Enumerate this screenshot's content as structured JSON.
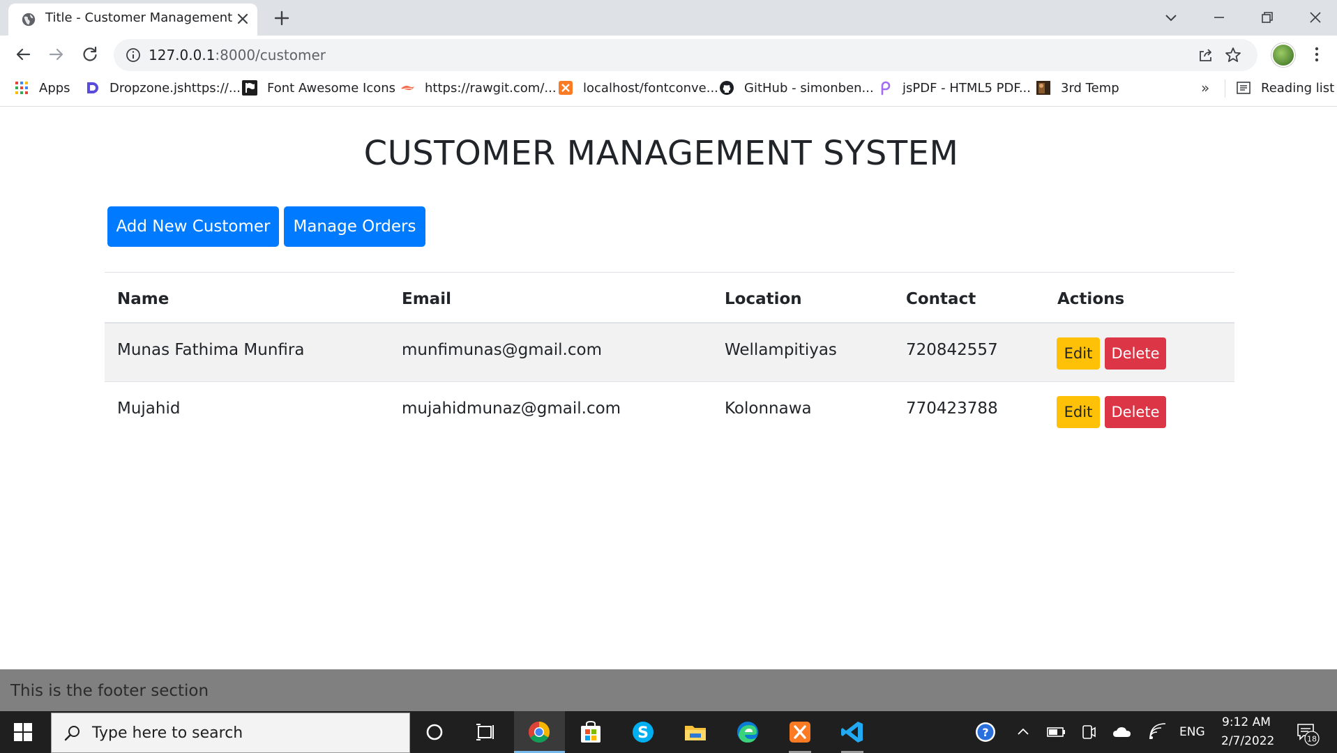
{
  "browser": {
    "tab_title": "Title - Customer Management",
    "url_host": "127.0.0.1",
    "url_path": ":8000/customer",
    "bookmarks": [
      {
        "label": "Apps",
        "icon": "apps-grid-icon"
      },
      {
        "label": "Dropzone.jshttps://...",
        "icon": "dropzone-icon"
      },
      {
        "label": "Font Awesome Icons",
        "icon": "font-awesome-flag-icon"
      },
      {
        "label": "https://rawgit.com/...",
        "icon": "rawgit-icon"
      },
      {
        "label": "localhost/fontconve...",
        "icon": "xampp-icon"
      },
      {
        "label": "GitHub - simonben...",
        "icon": "github-icon"
      },
      {
        "label": "jsPDF - HTML5 PDF...",
        "icon": "jspdf-icon"
      },
      {
        "label": "3rd Temp",
        "icon": "template-thumbnail-icon"
      }
    ],
    "bookmarks_overflow": "»",
    "reading_list": "Reading list"
  },
  "page": {
    "title": "CUSTOMER MANAGEMENT SYSTEM",
    "buttons": {
      "add_customer": "Add New Customer",
      "manage_orders": "Manage Orders"
    },
    "table": {
      "headers": [
        "Name",
        "Email",
        "Location",
        "Contact",
        "Actions"
      ],
      "rows": [
        {
          "name": "Munas Fathima Munfira",
          "email": "munfimunas@gmail.com",
          "location": "Wellampitiyas",
          "contact": "720842557"
        },
        {
          "name": "Mujahid",
          "email": "mujahidmunaz@gmail.com",
          "location": "Kolonnawa",
          "contact": "770423788"
        }
      ],
      "edit_label": "Edit",
      "delete_label": "Delete"
    },
    "footer": "This is the footer section"
  },
  "taskbar": {
    "search_placeholder": "Type here to search",
    "language": "ENG",
    "time": "9:12 AM",
    "date": "2/7/2022",
    "notification_count": "18"
  },
  "colors": {
    "primary": "#007bff",
    "warning": "#ffc107",
    "danger": "#dc3545",
    "footer_bg": "#808080",
    "taskbar_bg": "#1f1f1f"
  }
}
